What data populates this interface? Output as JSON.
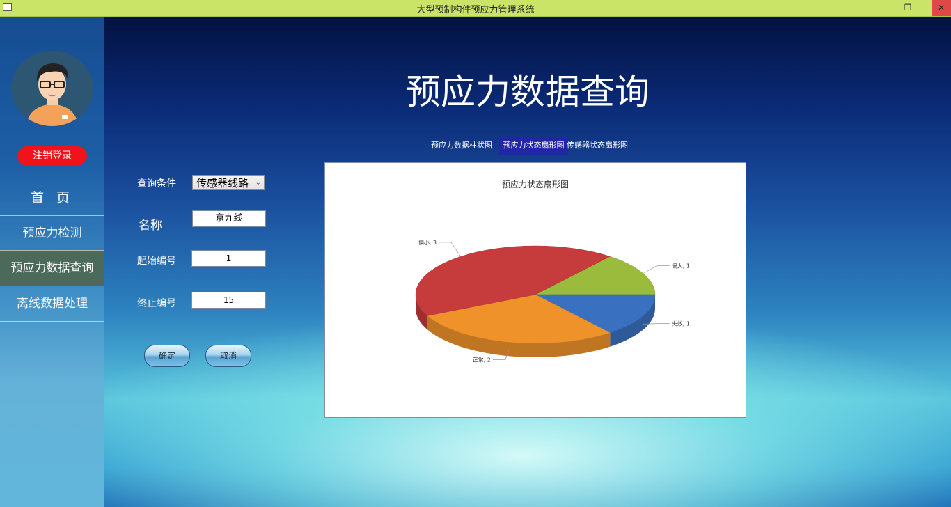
{
  "window": {
    "title": "大型预制构件预应力管理系统",
    "minimize": "–",
    "maximize": "❐",
    "close": "✕"
  },
  "sidebar": {
    "logout_label": "注销登录",
    "items": [
      {
        "label": "首 页"
      },
      {
        "label": "预应力检测"
      },
      {
        "label": "预应力数据查询"
      },
      {
        "label": "离线数据处理"
      }
    ],
    "active_index": 2
  },
  "main": {
    "title": "预应力数据查询",
    "tabs": [
      {
        "label": "预应力数据柱状图"
      },
      {
        "label": "预应力状态扇形图"
      },
      {
        "label": "传感器状态扇形图"
      }
    ],
    "active_tab": 1,
    "form": {
      "condition_label": "查询条件",
      "condition_value": "传感器线路",
      "name_label": "名称",
      "name_value": "京九线",
      "start_label": "起始编号",
      "start_value": "1",
      "end_label": "终止编号",
      "end_value": "15",
      "ok_label": "确定",
      "cancel_label": "取消"
    }
  },
  "chart_data": {
    "type": "pie",
    "title": "预应力状态扇形图",
    "slices": [
      {
        "label": "偏大",
        "value": 1,
        "color": "#9bbb3c"
      },
      {
        "label": "失效",
        "value": 1,
        "color": "#3a70c0"
      },
      {
        "label": "正常",
        "value": 2,
        "color": "#f0922a"
      },
      {
        "label": "偏小",
        "value": 3,
        "color": "#c63b3b"
      }
    ],
    "label_format": "{label}, {value}",
    "three_d": true
  }
}
